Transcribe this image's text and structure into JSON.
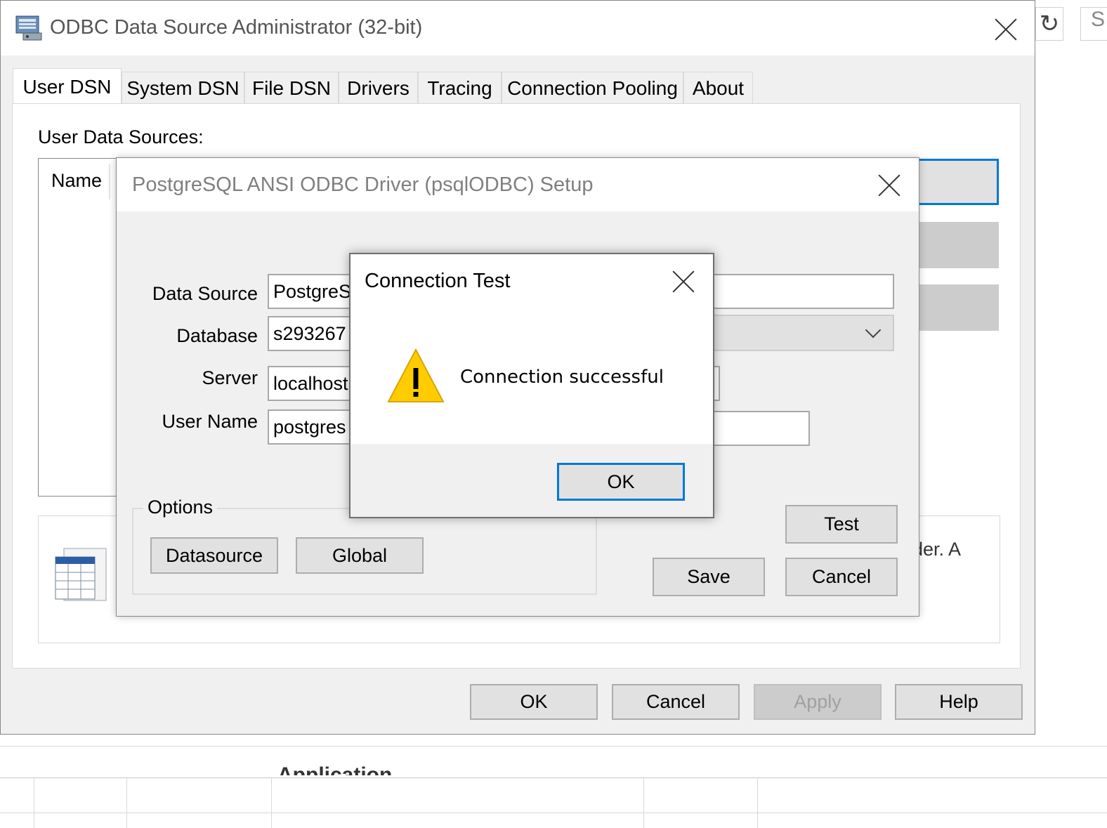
{
  "main_window": {
    "title": "ODBC Data Source Administrator (32-bit)",
    "tabs": [
      "User DSN",
      "System DSN",
      "File DSN",
      "Drivers",
      "Tracing",
      "Connection Pooling",
      "About"
    ],
    "active_tab": "User DSN",
    "section_label": "User Data Sources:",
    "column_header": "Name",
    "info_text_fragment": "der.  A",
    "buttons": {
      "ok": "OK",
      "cancel": "Cancel",
      "apply": "Apply",
      "help": "Help"
    }
  },
  "background": {
    "right_refresh_glyph": "↻",
    "right_partial_char": "S",
    "below_table_header_fragment": "Application",
    "behind_text_fragment": "..."
  },
  "setup_dialog": {
    "title": "PostgreSQL ANSI ODBC Driver (psqlODBC) Setup",
    "fields": {
      "data_source": {
        "label": "Data Source",
        "value": "PostgreS"
      },
      "database": {
        "label": "Database",
        "value": "s293267"
      },
      "server": {
        "label": "Server",
        "value": "localhost"
      },
      "user_name": {
        "label": "User Name",
        "value": "postgres"
      }
    },
    "options_label": "Options",
    "buttons": {
      "datasource": "Datasource",
      "global": "Global",
      "test": "Test",
      "save": "Save",
      "cancel": "Cancel"
    }
  },
  "message_box": {
    "title": "Connection Test",
    "message": "Connection successful",
    "icon": "warning-icon",
    "ok_label": "OK"
  },
  "colors": {
    "accent": "#0078d7",
    "dialog_bg": "#f0f0f0",
    "warning": "#ffcc00"
  }
}
